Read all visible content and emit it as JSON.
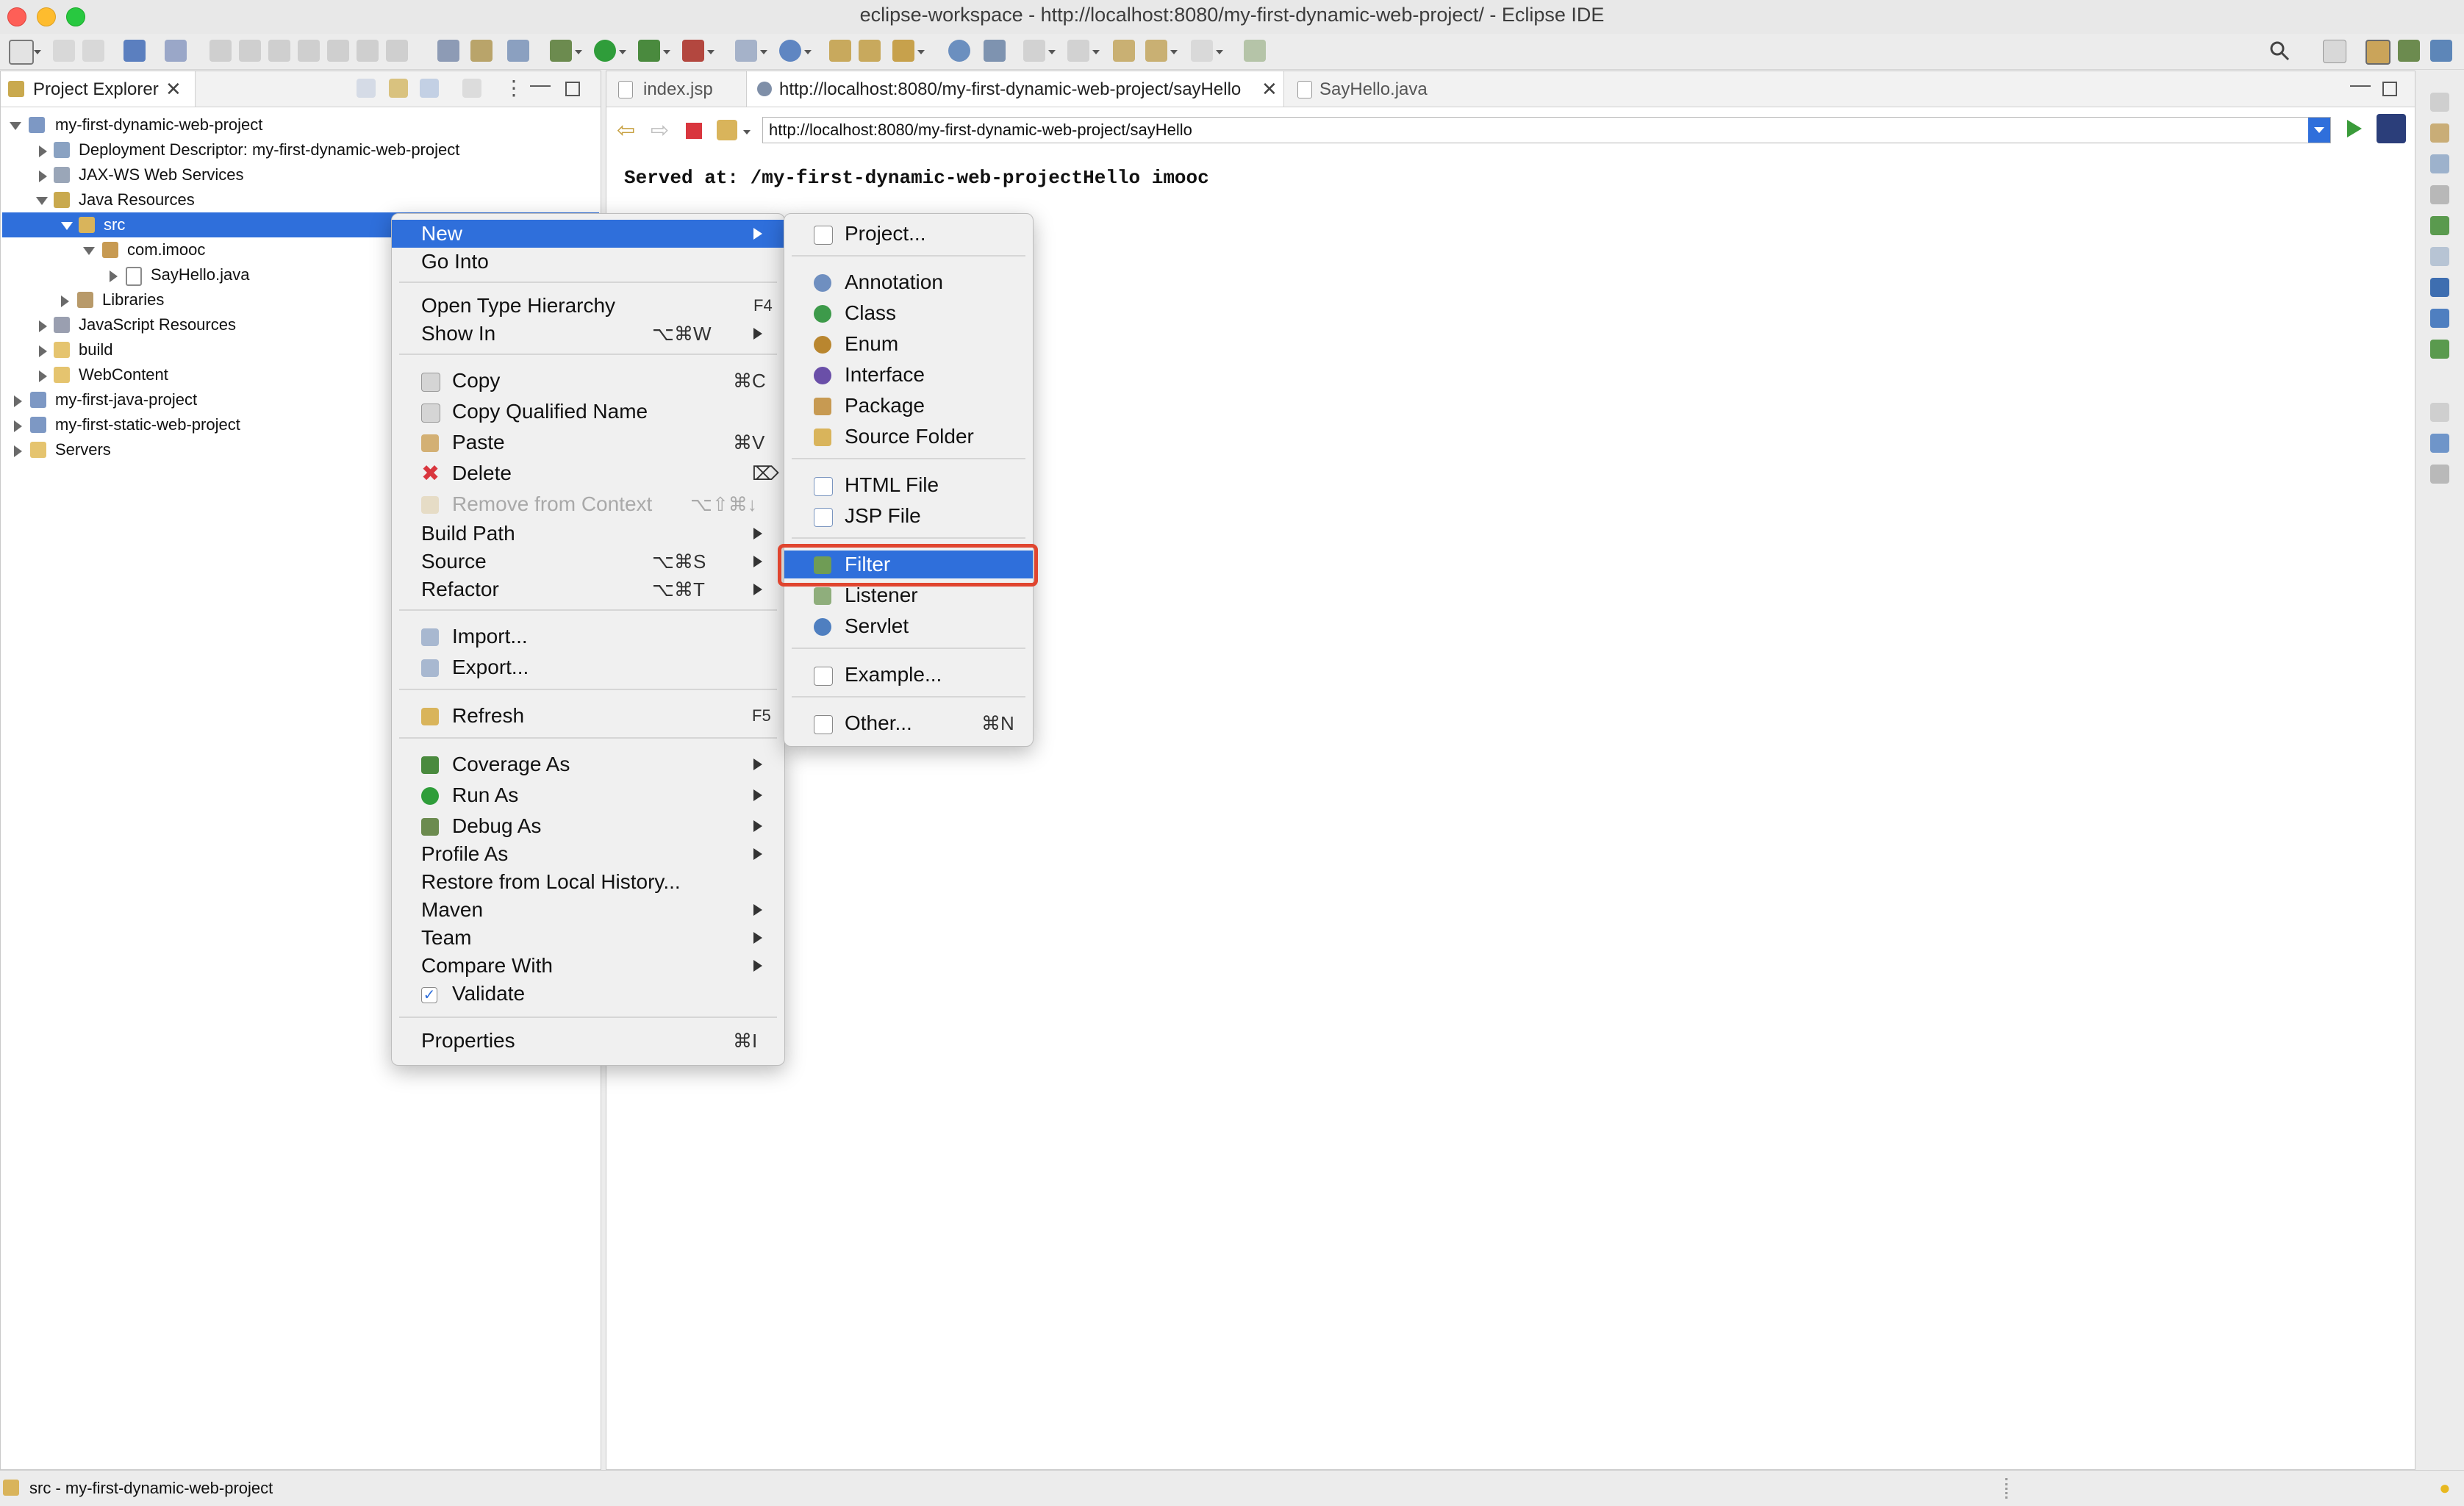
{
  "window": {
    "title": "eclipse-workspace - http://localhost:8080/my-first-dynamic-web-project/ - Eclipse IDE"
  },
  "project_explorer": {
    "tab_label": "Project Explorer",
    "tree": [
      {
        "label": "my-first-dynamic-web-project"
      },
      {
        "label": "Deployment Descriptor: my-first-dynamic-web-project"
      },
      {
        "label": "JAX-WS Web Services"
      },
      {
        "label": "Java Resources"
      },
      {
        "label": "src"
      },
      {
        "label": "com.imooc"
      },
      {
        "label": "SayHello.java"
      },
      {
        "label": "Libraries"
      },
      {
        "label": "JavaScript Resources"
      },
      {
        "label": "build"
      },
      {
        "label": "WebContent"
      },
      {
        "label": "my-first-java-project"
      },
      {
        "label": "my-first-static-web-project"
      },
      {
        "label": "Servers"
      }
    ]
  },
  "editor": {
    "tabs": [
      {
        "label": "index.jsp"
      },
      {
        "label": "http://localhost:8080/my-first-dynamic-web-project/sayHello"
      },
      {
        "label": "SayHello.java"
      }
    ],
    "url": "http://localhost:8080/my-first-dynamic-web-project/sayHello",
    "page_text": "Served at: /my-first-dynamic-web-projectHello imooc"
  },
  "context_menu": {
    "items": [
      {
        "label": "New"
      },
      {
        "label": "Go Into"
      },
      {
        "label": "Open Type Hierarchy",
        "shortcut": "F4"
      },
      {
        "label": "Show In",
        "shortcut": "⌥⌘W"
      },
      {
        "label": "Copy",
        "shortcut": "⌘C"
      },
      {
        "label": "Copy Qualified Name"
      },
      {
        "label": "Paste",
        "shortcut": "⌘V"
      },
      {
        "label": "Delete",
        "shortcut": "⌦"
      },
      {
        "label": "Remove from Context",
        "shortcut": "⌥⇧⌘↓"
      },
      {
        "label": "Build Path"
      },
      {
        "label": "Source",
        "shortcut": "⌥⌘S"
      },
      {
        "label": "Refactor",
        "shortcut": "⌥⌘T"
      },
      {
        "label": "Import..."
      },
      {
        "label": "Export..."
      },
      {
        "label": "Refresh",
        "shortcut": "F5"
      },
      {
        "label": "Coverage As"
      },
      {
        "label": "Run As"
      },
      {
        "label": "Debug As"
      },
      {
        "label": "Profile As"
      },
      {
        "label": "Restore from Local History..."
      },
      {
        "label": "Maven"
      },
      {
        "label": "Team"
      },
      {
        "label": "Compare With"
      },
      {
        "label": "Validate"
      },
      {
        "label": "Properties",
        "shortcut": "⌘I"
      }
    ]
  },
  "submenu_new": {
    "items": [
      {
        "label": "Project..."
      },
      {
        "label": "Annotation"
      },
      {
        "label": "Class"
      },
      {
        "label": "Enum"
      },
      {
        "label": "Interface"
      },
      {
        "label": "Package"
      },
      {
        "label": "Source Folder"
      },
      {
        "label": "HTML File"
      },
      {
        "label": "JSP File"
      },
      {
        "label": "Filter"
      },
      {
        "label": "Listener"
      },
      {
        "label": "Servlet"
      },
      {
        "label": "Example..."
      },
      {
        "label": "Other...",
        "shortcut": "⌘N"
      }
    ]
  },
  "status_bar": {
    "text": "src - my-first-dynamic-web-project"
  },
  "colors": {
    "selection": "#2f6fdb",
    "highlight_box": "#e0452f"
  }
}
